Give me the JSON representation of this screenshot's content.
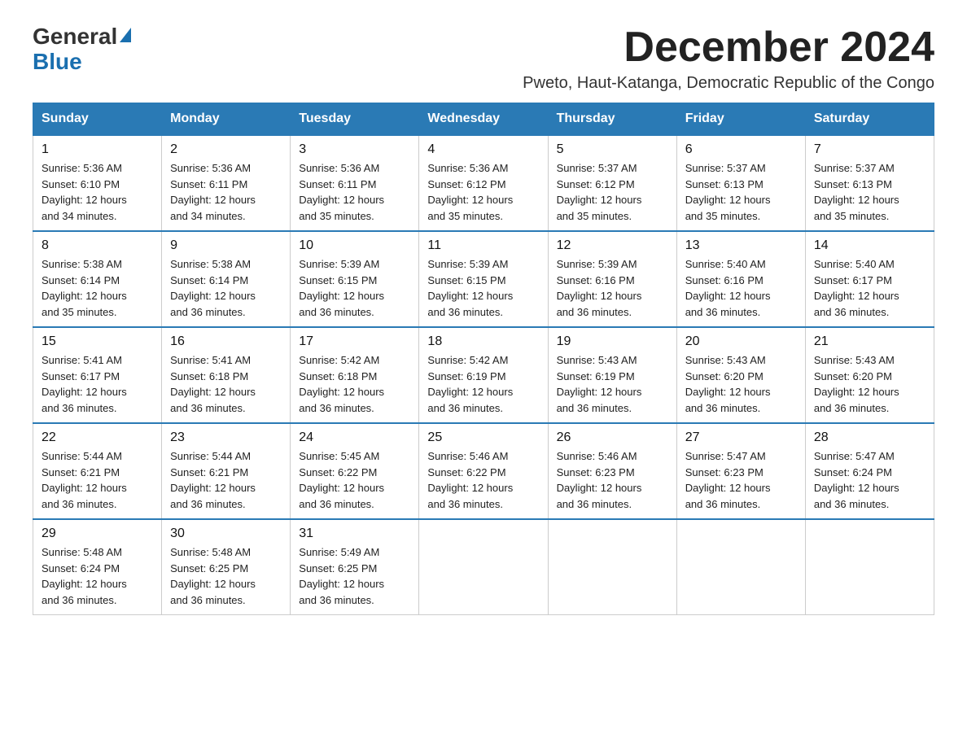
{
  "header": {
    "logo_general": "General",
    "logo_blue": "Blue",
    "month_title": "December 2024",
    "location": "Pweto, Haut-Katanga, Democratic Republic of the Congo"
  },
  "weekdays": [
    "Sunday",
    "Monday",
    "Tuesday",
    "Wednesday",
    "Thursday",
    "Friday",
    "Saturday"
  ],
  "weeks": [
    [
      {
        "day": "1",
        "sunrise": "5:36 AM",
        "sunset": "6:10 PM",
        "daylight": "12 hours and 34 minutes."
      },
      {
        "day": "2",
        "sunrise": "5:36 AM",
        "sunset": "6:11 PM",
        "daylight": "12 hours and 34 minutes."
      },
      {
        "day": "3",
        "sunrise": "5:36 AM",
        "sunset": "6:11 PM",
        "daylight": "12 hours and 35 minutes."
      },
      {
        "day": "4",
        "sunrise": "5:36 AM",
        "sunset": "6:12 PM",
        "daylight": "12 hours and 35 minutes."
      },
      {
        "day": "5",
        "sunrise": "5:37 AM",
        "sunset": "6:12 PM",
        "daylight": "12 hours and 35 minutes."
      },
      {
        "day": "6",
        "sunrise": "5:37 AM",
        "sunset": "6:13 PM",
        "daylight": "12 hours and 35 minutes."
      },
      {
        "day": "7",
        "sunrise": "5:37 AM",
        "sunset": "6:13 PM",
        "daylight": "12 hours and 35 minutes."
      }
    ],
    [
      {
        "day": "8",
        "sunrise": "5:38 AM",
        "sunset": "6:14 PM",
        "daylight": "12 hours and 35 minutes."
      },
      {
        "day": "9",
        "sunrise": "5:38 AM",
        "sunset": "6:14 PM",
        "daylight": "12 hours and 36 minutes."
      },
      {
        "day": "10",
        "sunrise": "5:39 AM",
        "sunset": "6:15 PM",
        "daylight": "12 hours and 36 minutes."
      },
      {
        "day": "11",
        "sunrise": "5:39 AM",
        "sunset": "6:15 PM",
        "daylight": "12 hours and 36 minutes."
      },
      {
        "day": "12",
        "sunrise": "5:39 AM",
        "sunset": "6:16 PM",
        "daylight": "12 hours and 36 minutes."
      },
      {
        "day": "13",
        "sunrise": "5:40 AM",
        "sunset": "6:16 PM",
        "daylight": "12 hours and 36 minutes."
      },
      {
        "day": "14",
        "sunrise": "5:40 AM",
        "sunset": "6:17 PM",
        "daylight": "12 hours and 36 minutes."
      }
    ],
    [
      {
        "day": "15",
        "sunrise": "5:41 AM",
        "sunset": "6:17 PM",
        "daylight": "12 hours and 36 minutes."
      },
      {
        "day": "16",
        "sunrise": "5:41 AM",
        "sunset": "6:18 PM",
        "daylight": "12 hours and 36 minutes."
      },
      {
        "day": "17",
        "sunrise": "5:42 AM",
        "sunset": "6:18 PM",
        "daylight": "12 hours and 36 minutes."
      },
      {
        "day": "18",
        "sunrise": "5:42 AM",
        "sunset": "6:19 PM",
        "daylight": "12 hours and 36 minutes."
      },
      {
        "day": "19",
        "sunrise": "5:43 AM",
        "sunset": "6:19 PM",
        "daylight": "12 hours and 36 minutes."
      },
      {
        "day": "20",
        "sunrise": "5:43 AM",
        "sunset": "6:20 PM",
        "daylight": "12 hours and 36 minutes."
      },
      {
        "day": "21",
        "sunrise": "5:43 AM",
        "sunset": "6:20 PM",
        "daylight": "12 hours and 36 minutes."
      }
    ],
    [
      {
        "day": "22",
        "sunrise": "5:44 AM",
        "sunset": "6:21 PM",
        "daylight": "12 hours and 36 minutes."
      },
      {
        "day": "23",
        "sunrise": "5:44 AM",
        "sunset": "6:21 PM",
        "daylight": "12 hours and 36 minutes."
      },
      {
        "day": "24",
        "sunrise": "5:45 AM",
        "sunset": "6:22 PM",
        "daylight": "12 hours and 36 minutes."
      },
      {
        "day": "25",
        "sunrise": "5:46 AM",
        "sunset": "6:22 PM",
        "daylight": "12 hours and 36 minutes."
      },
      {
        "day": "26",
        "sunrise": "5:46 AM",
        "sunset": "6:23 PM",
        "daylight": "12 hours and 36 minutes."
      },
      {
        "day": "27",
        "sunrise": "5:47 AM",
        "sunset": "6:23 PM",
        "daylight": "12 hours and 36 minutes."
      },
      {
        "day": "28",
        "sunrise": "5:47 AM",
        "sunset": "6:24 PM",
        "daylight": "12 hours and 36 minutes."
      }
    ],
    [
      {
        "day": "29",
        "sunrise": "5:48 AM",
        "sunset": "6:24 PM",
        "daylight": "12 hours and 36 minutes."
      },
      {
        "day": "30",
        "sunrise": "5:48 AM",
        "sunset": "6:25 PM",
        "daylight": "12 hours and 36 minutes."
      },
      {
        "day": "31",
        "sunrise": "5:49 AM",
        "sunset": "6:25 PM",
        "daylight": "12 hours and 36 minutes."
      },
      null,
      null,
      null,
      null
    ]
  ],
  "labels": {
    "sunrise_prefix": "Sunrise: ",
    "sunset_prefix": "Sunset: ",
    "daylight_prefix": "Daylight: "
  }
}
